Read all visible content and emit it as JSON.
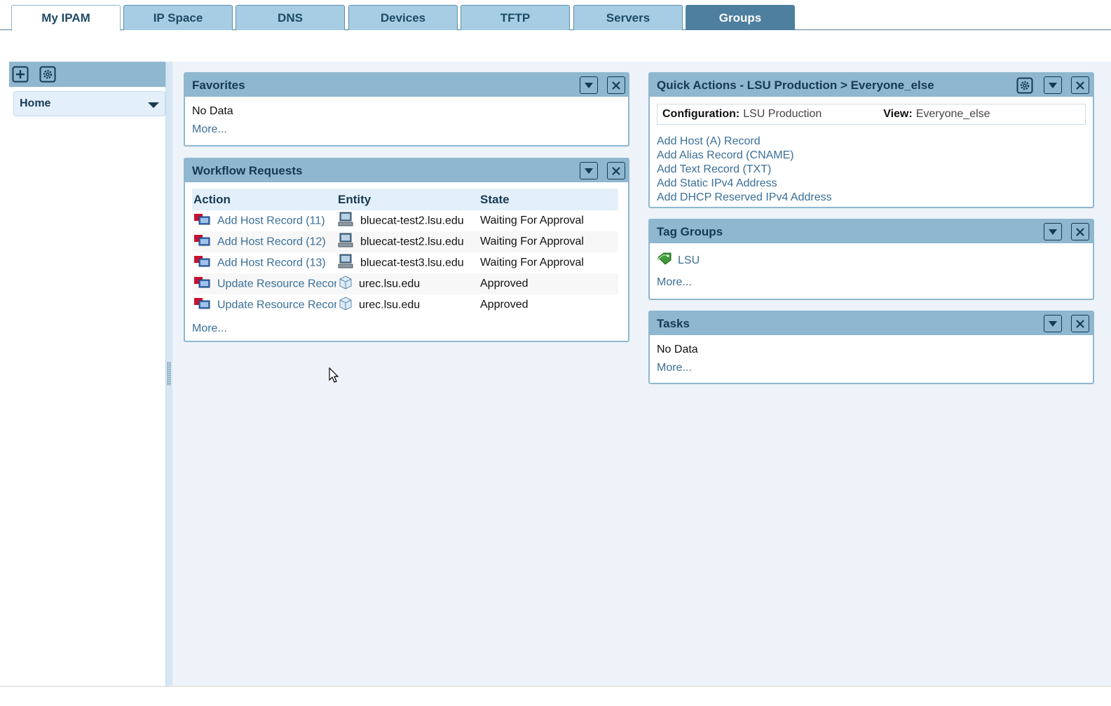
{
  "tabs": [
    "My IPAM",
    "IP Space",
    "DNS",
    "Devices",
    "TFTP",
    "Servers",
    "Groups"
  ],
  "sidebar": {
    "home_label": "Home"
  },
  "favorites": {
    "title": "Favorites",
    "empty": "No Data",
    "more": "More..."
  },
  "workflow": {
    "title": "Workflow Requests",
    "headers": {
      "action": "Action",
      "entity": "Entity",
      "state": "State"
    },
    "rows": [
      {
        "action": "Add Host Record (11)",
        "entity": "bluecat-test2.lsu.edu",
        "state": "Waiting For Approval",
        "entity_icon": "computer-icon"
      },
      {
        "action": "Add Host Record (12)",
        "entity": "bluecat-test2.lsu.edu",
        "state": "Waiting For Approval",
        "entity_icon": "computer-icon"
      },
      {
        "action": "Add Host Record (13)",
        "entity": "bluecat-test3.lsu.edu",
        "state": "Waiting For Approval",
        "entity_icon": "computer-icon"
      },
      {
        "action": "Update Resource Record",
        "entity": "urec.lsu.edu",
        "state": "Approved",
        "entity_icon": "cube-icon"
      },
      {
        "action": "Update Resource Record",
        "entity": "urec.lsu.edu",
        "state": "Approved",
        "entity_icon": "cube-icon"
      }
    ],
    "more": "More..."
  },
  "quick_actions": {
    "title": "Quick Actions - LSU Production > Everyone_else",
    "configuration_label": "Configuration:",
    "configuration_value": "LSU Production",
    "view_label": "View:",
    "view_value": "Everyone_else",
    "links": [
      "Add Host (A) Record",
      "Add Alias Record (CNAME)",
      "Add Text Record (TXT)",
      "Add Static IPv4 Address",
      "Add DHCP Reserved IPv4 Address"
    ]
  },
  "tag_groups": {
    "title": "Tag Groups",
    "items": [
      "LSU"
    ],
    "more": "More..."
  },
  "tasks": {
    "title": "Tasks",
    "empty": "No Data",
    "more": "More..."
  },
  "colors": {
    "header": "#8fb7cf",
    "tab": "#a6cde3",
    "tab_active_dark": "#4e7f9e",
    "link": "#3a6f98",
    "background": "#edf3f9"
  }
}
